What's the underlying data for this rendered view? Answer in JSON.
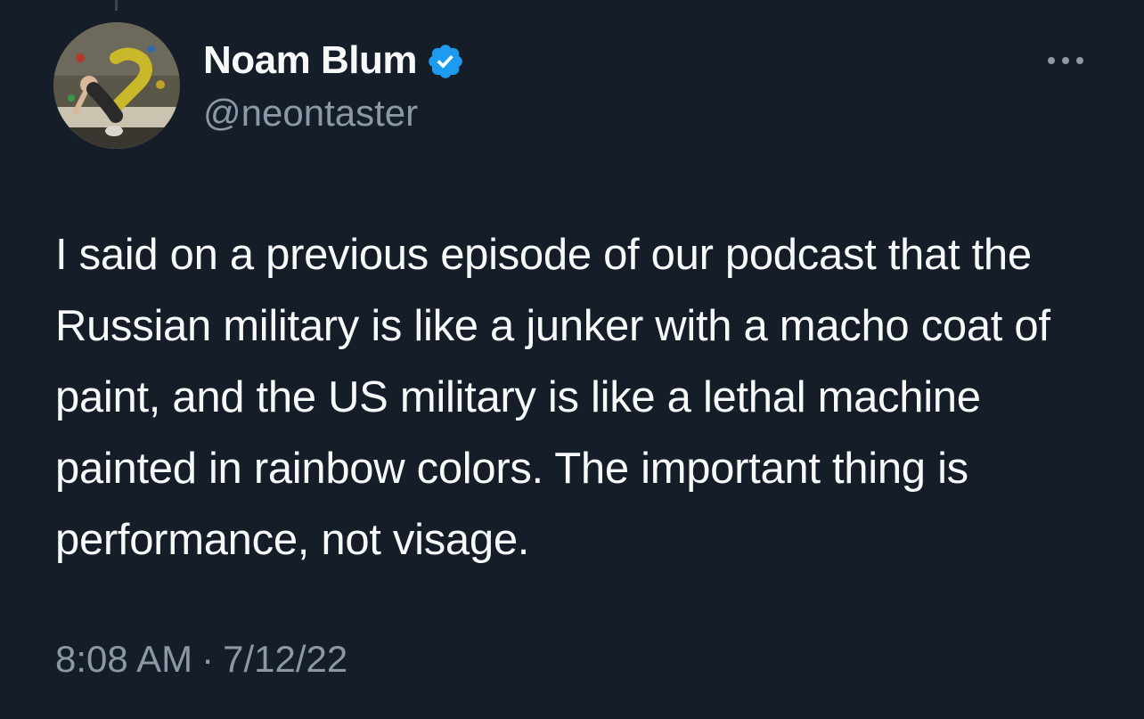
{
  "author": {
    "display_name": "Noam Blum",
    "handle": "@neontaster",
    "verified": true,
    "avatar_icon": "profile-photo-climber"
  },
  "tweet": {
    "text": "I said on a previous episode of our podcast that the Russian military is like a junker with a macho coat of paint, and the US military is like a lethal machine painted in rainbow colors. The important thing is performance, not visage.",
    "time": "8:08 AM",
    "separator": "·",
    "date": "7/12/22"
  },
  "icons": {
    "verified": "verified-badge-icon",
    "more": "more-options-icon"
  },
  "colors": {
    "background": "#151d29",
    "text_primary": "#f7f9f9",
    "text_secondary": "#8b98a5",
    "verified_blue": "#1d9bf0"
  }
}
